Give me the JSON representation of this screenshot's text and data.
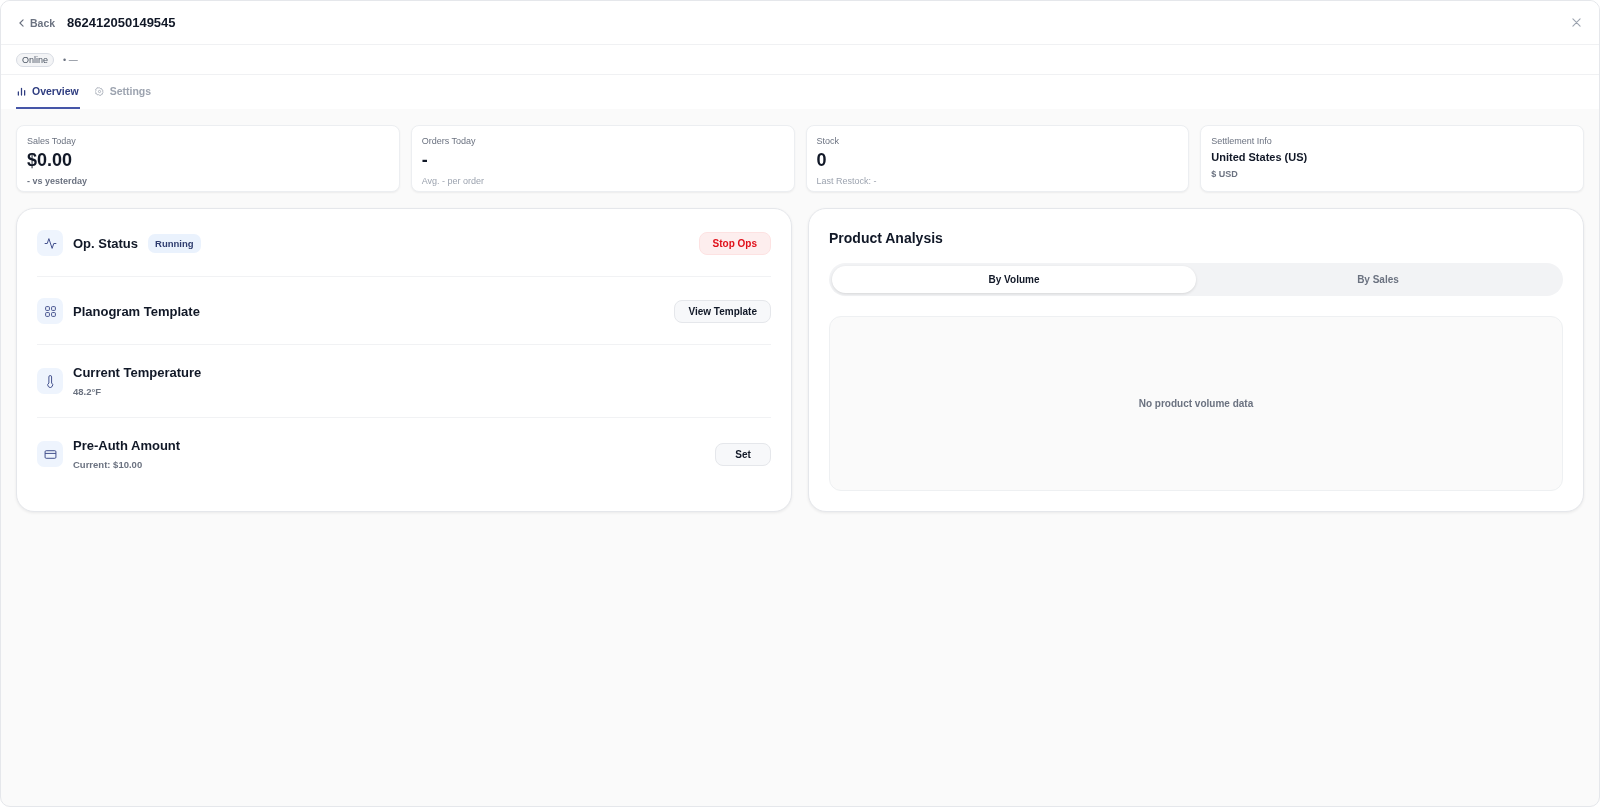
{
  "header": {
    "back": "Back",
    "title": "862412050149545"
  },
  "status": {
    "badge": "Online",
    "detail": "• —"
  },
  "tabs": [
    {
      "label": "Overview",
      "selected": true
    },
    {
      "label": "Settings",
      "selected": false
    }
  ],
  "stats": [
    {
      "kind": "metric",
      "label": "Sales Today",
      "value": "$0.00",
      "note": "- vs yesterday",
      "note_strong": true
    },
    {
      "kind": "metric",
      "label": "Orders Today",
      "value": "-",
      "note": "Avg. - per order",
      "note_strong": false
    },
    {
      "kind": "metric",
      "label": "Stock",
      "value": "0",
      "note": "Last Restock: -",
      "note_strong": false
    },
    {
      "kind": "text",
      "label": "Settlement Info",
      "value": "United States (US)",
      "note": "$ USD",
      "note_strong": true
    }
  ],
  "operations": [
    {
      "title": "Op. Status",
      "badge": "Running",
      "button": {
        "kind": "danger",
        "label": "Stop Ops"
      }
    },
    {
      "title": "Planogram Template",
      "button": {
        "kind": "secondary",
        "label": "View Template"
      }
    },
    {
      "title": "Current Temperature",
      "subtitle": "48.2°F"
    },
    {
      "title": "Pre-Auth Amount",
      "subtitle": "Current: $10.00",
      "button": {
        "kind": "secondary",
        "label": "Set"
      }
    }
  ],
  "analysis": {
    "title": "Product Analysis",
    "segments": [
      {
        "label": "By Volume",
        "selected": true
      },
      {
        "label": "By Sales",
        "selected": false
      }
    ],
    "empty": "No product volume data"
  }
}
